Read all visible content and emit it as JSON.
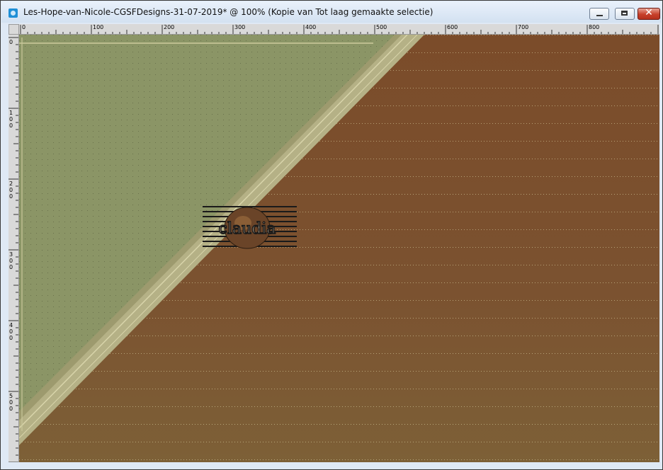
{
  "window": {
    "title": "Les-Hope-van-Nicole-CGSFDesigns-31-07-2019* @ 100% (Kopie van Tot laag gemaakte selectie)",
    "icon": "psp-image-icon",
    "minimize_icon": "minimize-icon",
    "maximize_icon": "maximize-icon",
    "close_icon": "close-icon",
    "close_glyph": "✕"
  },
  "ruler_top": {
    "labels": [
      "0",
      "100",
      "200",
      "300",
      "400",
      "500",
      "600",
      "700",
      "800"
    ]
  },
  "ruler_left": {
    "labels": [
      [
        "0"
      ],
      [
        "1",
        "0",
        "0"
      ],
      [
        "2",
        "0",
        "0"
      ],
      [
        "3",
        "0",
        "0"
      ],
      [
        "4",
        "0",
        "0"
      ],
      [
        "5",
        "0",
        "0"
      ]
    ]
  },
  "watermark": {
    "text": "claudia"
  },
  "colors": {
    "brown": "#7a4f2c",
    "green": "#8b9566",
    "stripe": "#b9b58a",
    "title_bg": "#dfe9f5",
    "close_red": "#c7402b"
  }
}
